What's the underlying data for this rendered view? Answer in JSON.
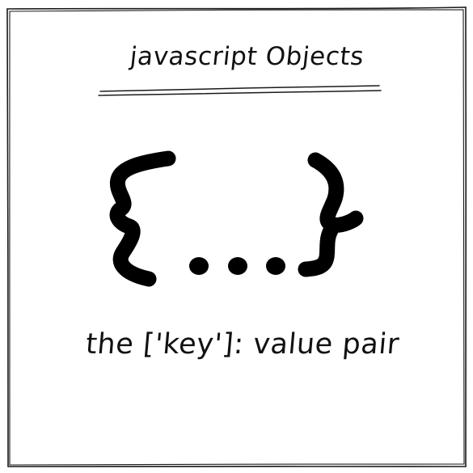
{
  "card": {
    "title": "javascript Objects",
    "subtitle": "the ['key']: value pair"
  },
  "illustration": {
    "icon": "curly-braces-ellipsis-icon"
  },
  "colors": {
    "ink": "#111111",
    "background": "#ffffff"
  }
}
